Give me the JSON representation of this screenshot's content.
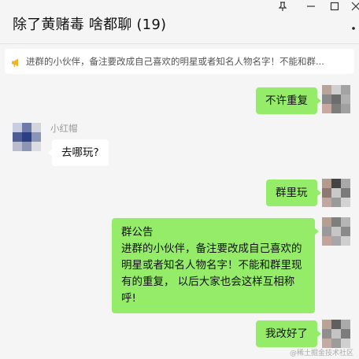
{
  "window": {
    "title": "除了黄赌毒 啥都聊 (19)",
    "pin_glyph": "⊥",
    "min_glyph": "—",
    "max_glyph": "□",
    "close_glyph": "×",
    "more_glyph": "·"
  },
  "notice": {
    "icon": "megaphone-icon",
    "text": "进群的小伙伴，备注要改成自己喜欢的明星或者知名人物名字！不能和群..."
  },
  "messages": [
    {
      "side": "right",
      "text": "不许重复"
    },
    {
      "side": "left",
      "sender": "小红帽",
      "text": "去哪玩?"
    },
    {
      "side": "right",
      "text": "群里玩"
    },
    {
      "side": "right",
      "text": "群公告\n进群的小伙伴，备注要改成自己喜欢的明星或者知名人物名字！不能和群里现有的重复， 以后大家也会这样互相称呼!"
    },
    {
      "side": "right",
      "text": "我改好了"
    }
  ],
  "watermark": "@稀土掘金技术社区",
  "colors": {
    "bubble_self": "#95ec69",
    "bubble_other": "#ffffff",
    "background": "#f5f5f5"
  }
}
